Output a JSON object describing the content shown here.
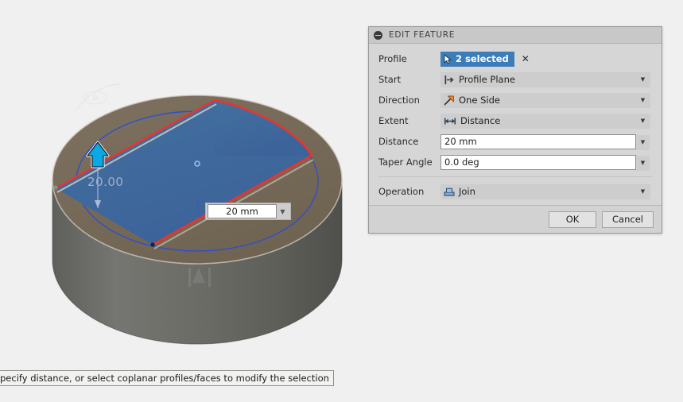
{
  "dialog": {
    "title": "EDIT FEATURE",
    "collapse_icon": "minus-circle-icon",
    "rows": {
      "profile": {
        "label": "Profile",
        "chip_text": "2 selected",
        "chip_icon": "cursor-arrow-icon",
        "clear_icon": "close-x-icon"
      },
      "start": {
        "label": "Start",
        "value": "Profile Plane",
        "icon": "profile-plane-icon"
      },
      "direction": {
        "label": "Direction",
        "value": "One Side",
        "icon": "one-side-arrow-icon"
      },
      "extent": {
        "label": "Extent",
        "value": "Distance",
        "icon": "distance-measure-icon"
      },
      "distance": {
        "label": "Distance",
        "value": "20 mm"
      },
      "taper_angle": {
        "label": "Taper Angle",
        "value": "0.0 deg"
      },
      "operation": {
        "label": "Operation",
        "value": "Join",
        "icon": "join-boolean-icon"
      }
    },
    "buttons": {
      "ok": "OK",
      "cancel": "Cancel"
    }
  },
  "viewport": {
    "dimension_badge": {
      "value": "20 mm",
      "caret_icon": "chevron-down-icon"
    },
    "ghost_dimension": "20.00",
    "manipulator_icon": "extrude-arrow-handle-icon",
    "colors": {
      "background": "#f0f0f0",
      "profile_fill": "#41699e",
      "top_face": "#786b58",
      "side_face": "#6b6b66",
      "highlight_edge": "#e8352e",
      "sketch_curve": "#2f4fd0"
    }
  },
  "status_bar": {
    "text": "pecify distance, or select coplanar profiles/faces to modify the selection"
  }
}
